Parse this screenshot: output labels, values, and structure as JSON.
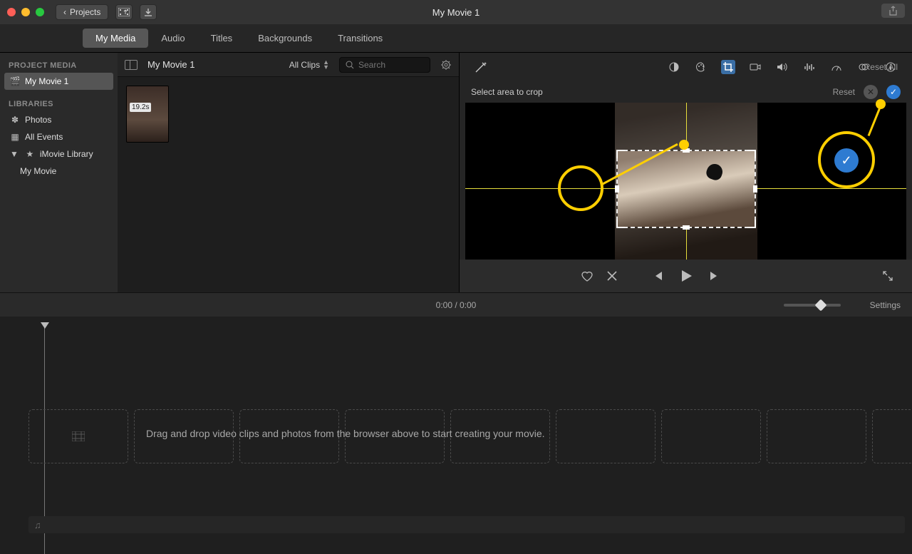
{
  "titlebar": {
    "projects_btn": "Projects",
    "title": "My Movie 1"
  },
  "tabs": [
    "My Media",
    "Audio",
    "Titles",
    "Backgrounds",
    "Transitions"
  ],
  "sidebar": {
    "project_media_heading": "PROJECT MEDIA",
    "project": "My Movie 1",
    "libraries_heading": "LIBRARIES",
    "photos": "Photos",
    "all_events": "All Events",
    "imovie_library": "iMovie Library",
    "my_movie": "My Movie"
  },
  "browser": {
    "breadcrumb": "My Movie 1",
    "filter": "All Clips",
    "search_placeholder": "Search",
    "clip_duration": "19.2s"
  },
  "viewer": {
    "reset_all": "Reset All",
    "instruction": "Select area to crop",
    "reset": "Reset"
  },
  "timeline": {
    "time": "0:00 / 0:00",
    "settings": "Settings",
    "hint": "Drag and drop video clips and photos from the browser above to start creating your movie."
  }
}
